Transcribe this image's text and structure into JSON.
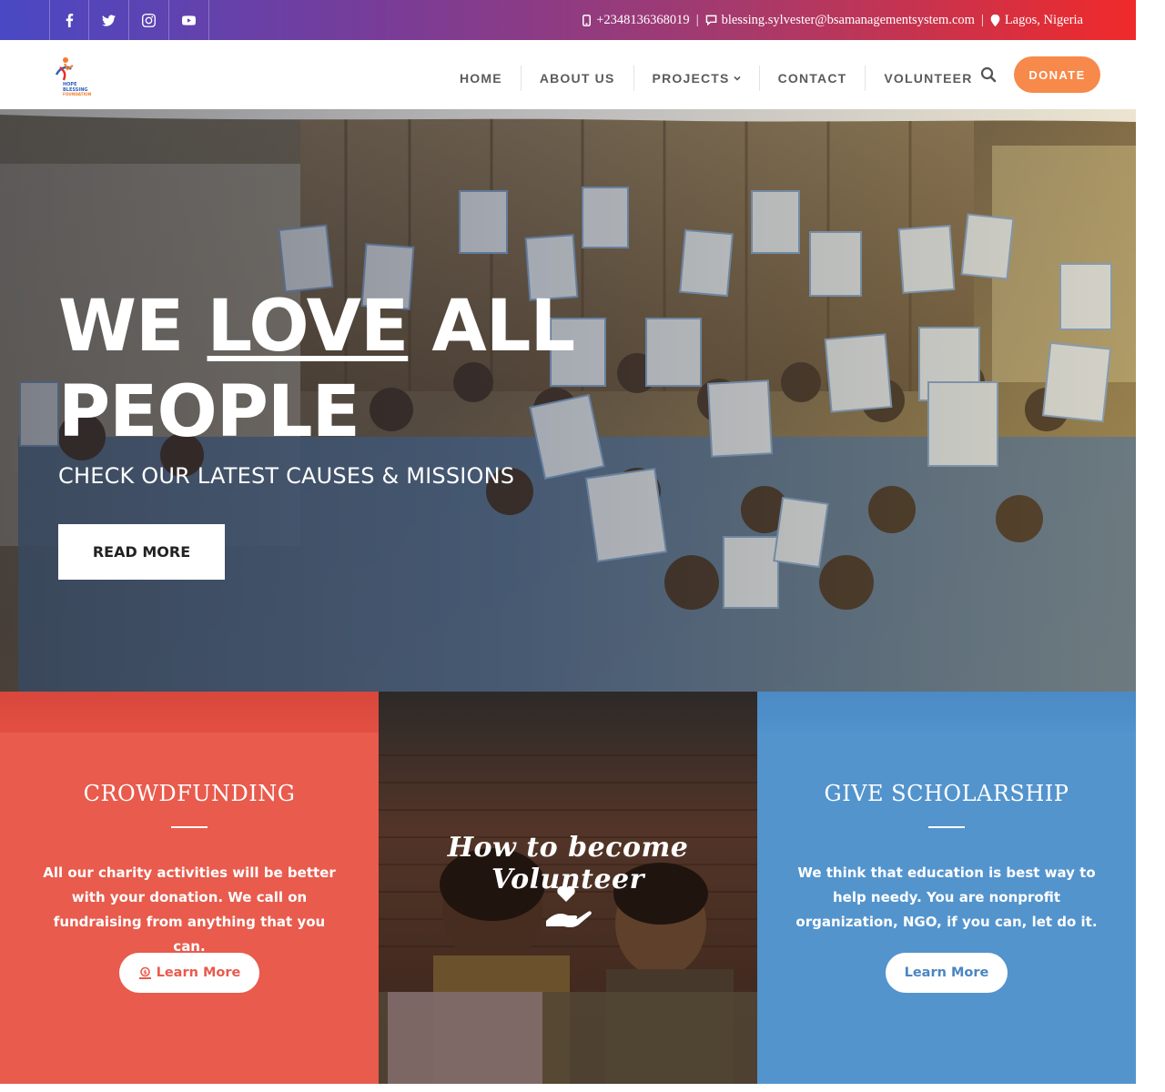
{
  "topbar": {
    "socials": [
      {
        "icon": "facebook-icon"
      },
      {
        "icon": "twitter-icon"
      },
      {
        "icon": "instagram-icon"
      },
      {
        "icon": "youtube-icon"
      }
    ],
    "phone": "+2348136368019",
    "email": "blessing.sylvester@bsamanagementsystem.com",
    "location": "Lagos, Nigeria",
    "separator": "|"
  },
  "logo": {
    "line1": "HOPE",
    "line2": "BLESSING",
    "line3": "FOUNDATION"
  },
  "nav": {
    "items": [
      "HOME",
      "ABOUT US",
      "PROJECTS",
      "CONTACT",
      "VOLUNTEER"
    ],
    "donate": "DONATE"
  },
  "hero": {
    "title_pre": "WE ",
    "title_love": "LOVE",
    "title_post": " ALL PEOPLE",
    "subtitle": "CHECK OUR LATEST CAUSES & MISSIONS",
    "button": "READ MORE"
  },
  "features": {
    "crowdfunding": {
      "title": "CROWDFUNDING",
      "text": "All our charity activities will be better with your donation. We call on fundraising from anything that you can.",
      "button": "Learn More"
    },
    "volunteer": {
      "title": "How to become Volunteer"
    },
    "scholarship": {
      "title": "GIVE SCHOLARSHIP",
      "text": "We think that education is best way to help needy. You are nonprofit organization, NGO, if you can, let do it.",
      "button": "Learn More"
    }
  },
  "colors": {
    "accent_orange": "#f7894a",
    "panel_red": "#e85b4d",
    "panel_blue": "#5394cd",
    "topbar_start": "#4a48c4",
    "topbar_end": "#f02a2a"
  }
}
